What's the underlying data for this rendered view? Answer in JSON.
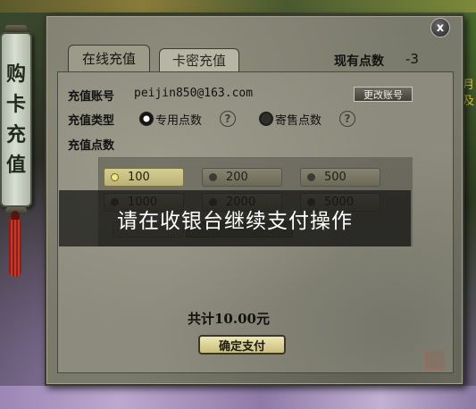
{
  "banner": {
    "chars": [
      "购",
      "卡",
      "充",
      "值"
    ]
  },
  "side": {
    "glyph_a": "月",
    "glyph_b": "及"
  },
  "dialog": {
    "close_label": "x",
    "tabs": [
      {
        "label": "在线充值",
        "active": true
      },
      {
        "label": "卡密充值",
        "active": false
      }
    ],
    "points": {
      "label": "现有点数",
      "value": "-3"
    }
  },
  "form": {
    "account_label": "充值账号",
    "account_value": "peijin850@163.com",
    "change_button": "更改账号",
    "type_label": "充值类型",
    "type_options": [
      {
        "label": "专用点数",
        "selected": true
      },
      {
        "label": "寄售点数",
        "selected": false
      }
    ],
    "points_label": "充值点数",
    "amounts": [
      {
        "label": "100",
        "selected": true
      },
      {
        "label": "200",
        "selected": false
      },
      {
        "label": "500",
        "selected": false
      },
      {
        "label": "1000",
        "selected": false
      },
      {
        "label": "2000",
        "selected": false
      },
      {
        "label": "5000",
        "selected": false
      }
    ]
  },
  "overlay_message": "请在收银台继续支付操作",
  "total": "共计10.00元",
  "confirm_button": "确定支付",
  "help_icon": "?",
  "colors": {
    "panel": "#8c8b7d",
    "selected_amount": "#d6ce90",
    "overlay": "#141412"
  }
}
